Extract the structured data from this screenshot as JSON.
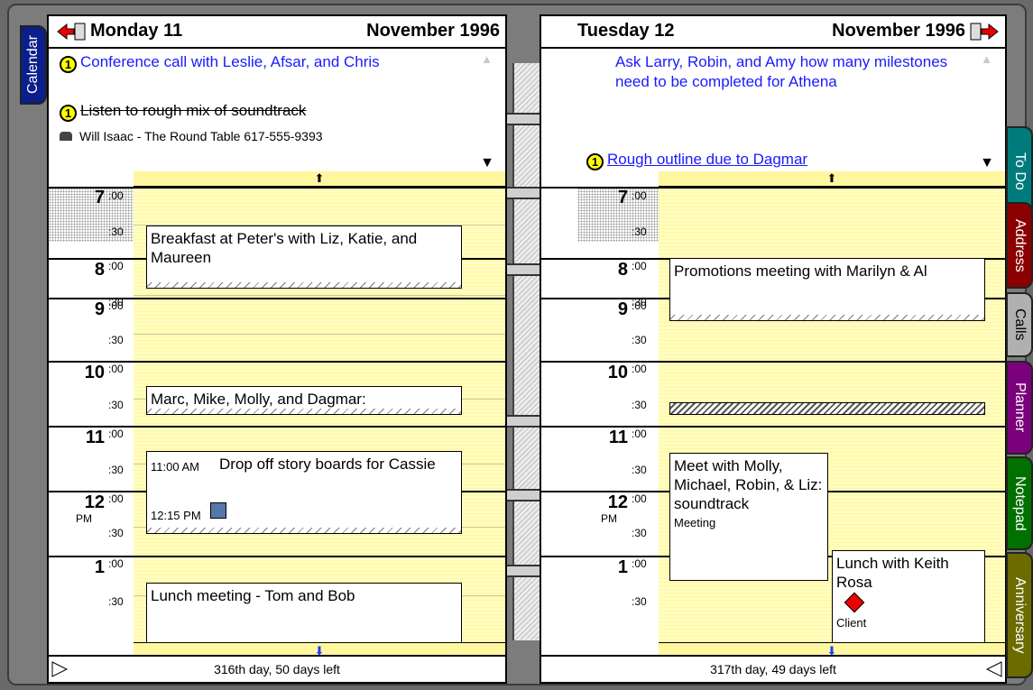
{
  "left_page": {
    "day_title": "Monday 11",
    "month_year": "November 1996",
    "notes": [
      {
        "badge": "1",
        "text": "Conference call with Leslie, Afsar, and Chris"
      },
      {
        "badge": "1",
        "text": "Listen to rough mix of soundtrack"
      },
      {
        "text": "Will Isaac - The Round Table   617-555-9393"
      }
    ],
    "times": [
      {
        "hour": "7",
        "min": ":00"
      },
      {
        "hour": "8",
        "min": ":00"
      },
      {
        "hour": "9",
        "min": ":00"
      },
      {
        "hour": "10",
        "min": ":00"
      },
      {
        "hour": "11",
        "min": ":00"
      },
      {
        "hour": "12",
        "min": ":00",
        "pm": "PM"
      },
      {
        "hour": "1",
        "min": ":00"
      }
    ],
    "half": ":30",
    "appointments": [
      {
        "text": "Breakfast at Peter's with Liz, Katie, and Maureen"
      },
      {
        "text": "Marc, Mike, Molly, and Dagmar:"
      },
      {
        "start": "11:00 AM",
        "text": "Drop off story boards for Cassie",
        "end": "12:15 PM"
      },
      {
        "text": "Lunch meeting - Tom and Bob"
      }
    ],
    "footer": "316th day, 50 days left"
  },
  "right_page": {
    "day_title": "Tuesday 12",
    "month_year": "November 1996",
    "notes": [
      {
        "text": "Ask Larry, Robin, and Amy how many milestones need to be completed for Athena"
      },
      {
        "badge": "1",
        "text": "Rough outline due to Dagmar"
      }
    ],
    "times": [
      {
        "hour": "7",
        "min": ":00"
      },
      {
        "hour": "8",
        "min": ":00"
      },
      {
        "hour": "9",
        "min": ":00"
      },
      {
        "hour": "10",
        "min": ":00"
      },
      {
        "hour": "11",
        "min": ":00"
      },
      {
        "hour": "12",
        "min": ":00",
        "pm": "PM"
      },
      {
        "hour": "1",
        "min": ":00"
      }
    ],
    "half": ":30",
    "appointments": [
      {
        "text": "Promotions meeting with Marilyn & Al"
      },
      {
        "text": "Meet with Molly, Michael, Robin, & Liz: soundtrack",
        "sub": "Meeting"
      },
      {
        "text": "Lunch with Keith Rosa",
        "sub": "Client"
      }
    ],
    "footer": "317th day, 49 days left"
  },
  "tabs": {
    "calendar": "Calendar",
    "right": [
      "To Do",
      "Address",
      "Calls",
      "Planner",
      "Notepad",
      "Anniversary"
    ]
  },
  "colors": {
    "calendar_tab": "#0a1e8c",
    "todo_tab": "#007b7b",
    "address_tab": "#8b0000",
    "calls_tab": "#b0b0b0",
    "planner_tab": "#7b007b",
    "notepad_tab": "#007000",
    "anniversary_tab": "#6b6b00",
    "note_text": "#1a1aff",
    "schedule_bg": "#fffdbf"
  }
}
